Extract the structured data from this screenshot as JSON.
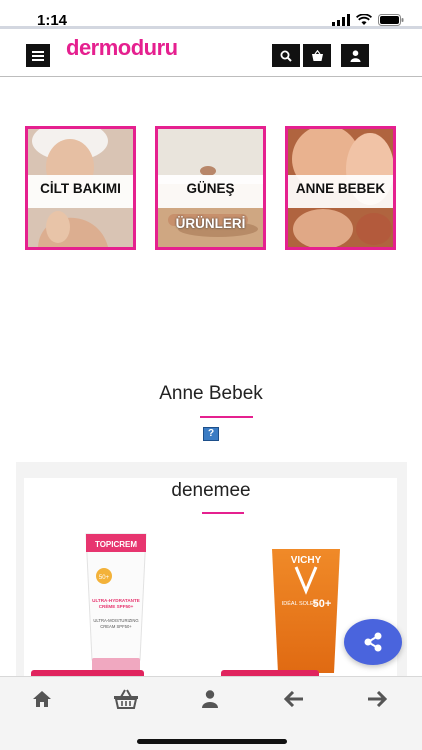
{
  "status": {
    "time": "1:14"
  },
  "header": {
    "logo": "dermoduru",
    "icons": [
      "menu-icon",
      "search-icon",
      "cart-icon",
      "user-icon"
    ]
  },
  "categories": [
    {
      "label": "CİLT BAKIMI",
      "label2": ""
    },
    {
      "label": "GÜNEŞ",
      "label2": "ÜRÜNLERİ"
    },
    {
      "label": "ANNE BEBEK",
      "label2": ""
    }
  ],
  "section": {
    "title": "Anne Bebek",
    "help": "?"
  },
  "panel": {
    "title": "denemee",
    "products": [
      {
        "brand": "TOPICREM",
        "line1": "ULTRA-HYDRATANTE",
        "line2": "CRÈME SPF50+",
        "line3": "ULTRA-MOISTURIZING",
        "line4": "CREAM SPF50+",
        "spf": "50+"
      },
      {
        "brand": "VICHY",
        "line1": "IDÉAL SOLEIL",
        "spf": "50+"
      }
    ]
  },
  "colors": {
    "accent": "#e5208f",
    "fab": "#4a64dd",
    "product_button": "#e0245e"
  },
  "bottom_nav": [
    "home-icon",
    "basket-icon",
    "user-icon",
    "arrow-left-icon",
    "arrow-right-icon"
  ]
}
